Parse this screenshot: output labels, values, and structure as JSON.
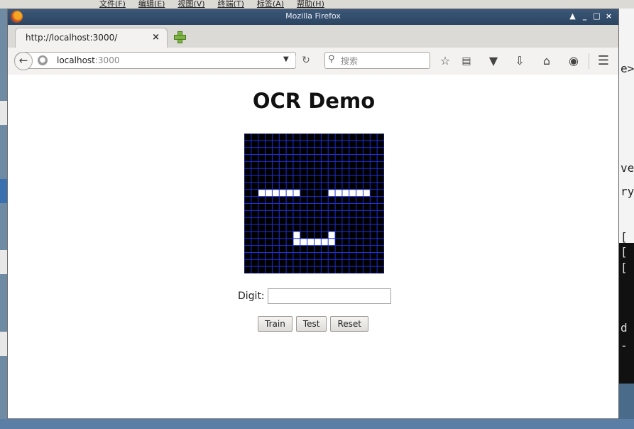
{
  "desktop": {
    "menu_items": [
      "文件(F)",
      "编辑(E)",
      "视图(V)",
      "终端(T)",
      "标签(A)",
      "帮助(H)"
    ],
    "terminal_lines": [
      "e>",
      "ve",
      "ry",
      "[",
      "[",
      "[",
      "d",
      "-"
    ]
  },
  "window": {
    "title": "Mozilla Firefox",
    "controls": [
      "▲",
      "_",
      "□",
      "×"
    ]
  },
  "tab": {
    "label": "http://localhost:3000/",
    "close": "×"
  },
  "urlbar": {
    "host": "localhost",
    "port": ":3000"
  },
  "search": {
    "placeholder": "搜索"
  },
  "toolbar_icons": [
    "star-icon",
    "reading-list-icon",
    "pocket-icon",
    "download-icon",
    "home-icon",
    "chat-icon",
    "menu-icon"
  ],
  "page": {
    "title": "OCR Demo",
    "digit_label": "Digit:",
    "digit_value": "",
    "buttons": {
      "train": "Train",
      "test": "Test",
      "reset": "Reset"
    }
  },
  "grid": {
    "size": 20,
    "background": "#000000",
    "line_color": "#1f2fd6",
    "fill_color": "#ffffff",
    "filled_cells": [
      [
        2,
        8
      ],
      [
        3,
        8
      ],
      [
        4,
        8
      ],
      [
        5,
        8
      ],
      [
        6,
        8
      ],
      [
        7,
        8
      ],
      [
        12,
        8
      ],
      [
        13,
        8
      ],
      [
        14,
        8
      ],
      [
        15,
        8
      ],
      [
        16,
        8
      ],
      [
        17,
        8
      ],
      [
        7,
        14
      ],
      [
        7,
        15
      ],
      [
        8,
        15
      ],
      [
        9,
        15
      ],
      [
        10,
        15
      ],
      [
        11,
        15
      ],
      [
        12,
        15
      ],
      [
        12,
        14
      ]
    ]
  }
}
